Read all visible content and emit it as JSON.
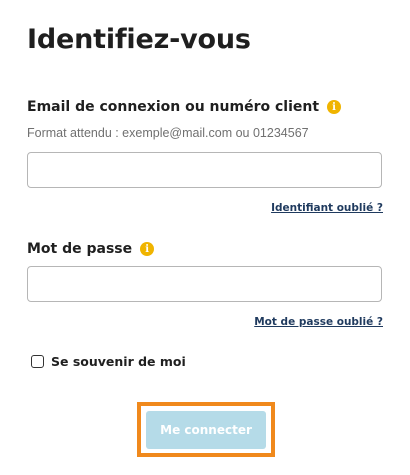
{
  "page": {
    "title": "Identifiez-vous"
  },
  "login_field": {
    "label": "Email de connexion ou numéro client",
    "info_icon": "info-icon",
    "hint": "Format attendu : exemple@mail.com ou 01234567",
    "value": "",
    "placeholder": "",
    "forgot_link": "Identifiant oublié ?"
  },
  "password_field": {
    "label": "Mot de passe",
    "info_icon": "info-icon",
    "value": "",
    "placeholder": "",
    "forgot_link": "Mot de passe oublié ?"
  },
  "remember_me": {
    "label": "Se souvenir de moi",
    "checked": false
  },
  "submit": {
    "label": "Me connecter",
    "enabled": false
  },
  "colors": {
    "info_icon": "#f0b400",
    "submit_button": "#b5dbe8",
    "highlight_border": "#f0891c",
    "link": "#1f3a5e"
  }
}
